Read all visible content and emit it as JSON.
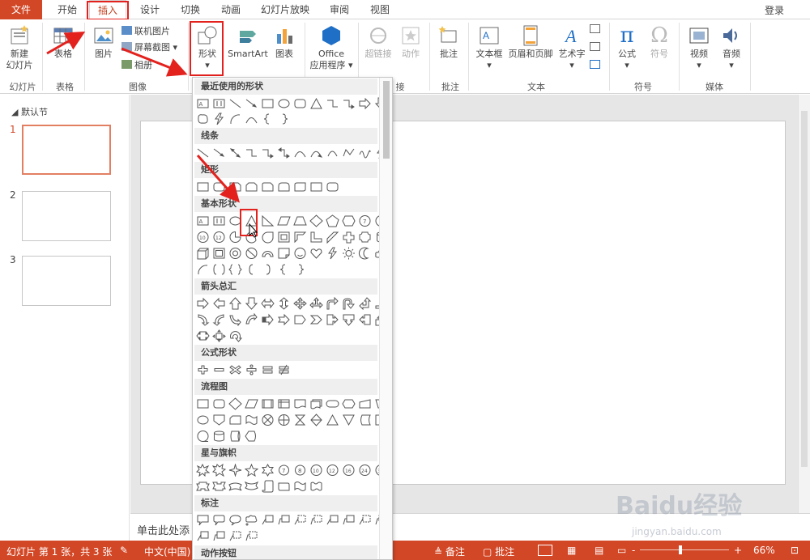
{
  "tabs": {
    "file": "文件",
    "home": "开始",
    "insert": "插入",
    "design": "设计",
    "transitions": "切换",
    "animations": "动画",
    "slideshow": "幻灯片放映",
    "review": "审阅",
    "view": "视图",
    "login": "登录"
  },
  "ribbon": {
    "new_slide": "新建",
    "new_slide2": "幻灯片",
    "table": "表格",
    "picture": "图片",
    "online_pictures": "联机图片",
    "screenshot": "屏幕截图",
    "album": "相册",
    "shapes": "形状",
    "smartart": "SmartArt",
    "chart": "图表",
    "office_apps": "Office",
    "office_apps2": "应用程序",
    "hyperlink": "超链接",
    "action": "动作",
    "comment": "批注",
    "textbox": "文本框",
    "header_footer": "页眉和页脚",
    "wordart": "艺术字",
    "equation": "公式",
    "symbol": "符号",
    "video": "视频",
    "audio": "音频",
    "groups": {
      "slides": "幻灯片",
      "tables": "表格",
      "images": "图像",
      "links": "接",
      "comments": "批注",
      "text": "文本",
      "symbols": "符号",
      "media": "媒体"
    }
  },
  "thumbs": {
    "section": "默认节",
    "numbers": [
      "1",
      "2",
      "3"
    ]
  },
  "shapes_menu": {
    "recent": "最近使用的形状",
    "lines": "线条",
    "rectangles": "矩形",
    "basic": "基本形状",
    "arrows": "箭头总汇",
    "equation": "公式形状",
    "flowchart": "流程图",
    "stars": "星与旗帜",
    "callouts": "标注",
    "action_buttons": "动作按钮"
  },
  "notes": {
    "placeholder": "单击此处添"
  },
  "status": {
    "slide_info": "幻灯片 第 1 张，共 3 张",
    "language": "中文(中国)",
    "notes": "备注",
    "comments": "批注",
    "zoom": "66%",
    "minus": "-",
    "plus": "+"
  },
  "watermark": {
    "brand": "Baidu经验",
    "url": "jingyan.baidu.com"
  },
  "colors": {
    "accent": "#d24726",
    "highlight": "#e3211d"
  }
}
